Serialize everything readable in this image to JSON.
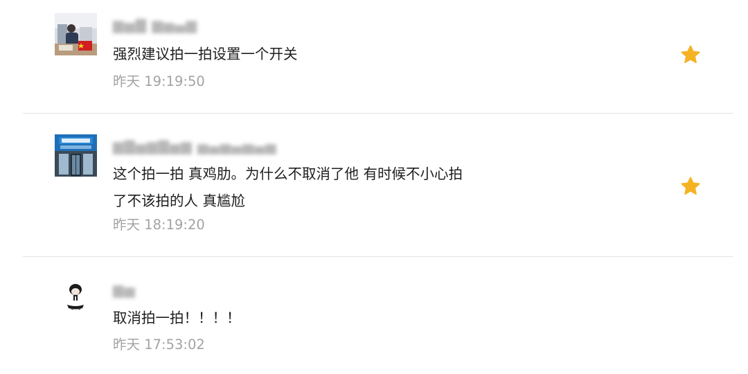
{
  "comments": [
    {
      "username": "▆▅▇ ▆▅▄▆",
      "text": "强烈建议拍一拍设置一个开关",
      "time": "昨天 19:19:50",
      "favorited": true,
      "avatar_icon": "person-photo-avatar"
    },
    {
      "username": "▆▇▅▆▇▅▆ ▅▄▅▄▅▄▅",
      "text": "这个拍一拍 真鸡肋。为什么不取消了他 有时候不小心拍\n了不该拍的人 真尴尬",
      "time": "昨天 18:19:20",
      "favorited": true,
      "avatar_icon": "storefront-photo-avatar"
    },
    {
      "username": "▆▅",
      "text": "取消拍一拍！！！！",
      "time": "昨天 17:53:02",
      "favorited": false,
      "avatar_icon": "cartoon-figure-avatar"
    }
  ],
  "colors": {
    "star": "#f5b324",
    "divider": "#e2e2e2",
    "time": "#a3a3a3",
    "text": "#1e1e1e"
  }
}
